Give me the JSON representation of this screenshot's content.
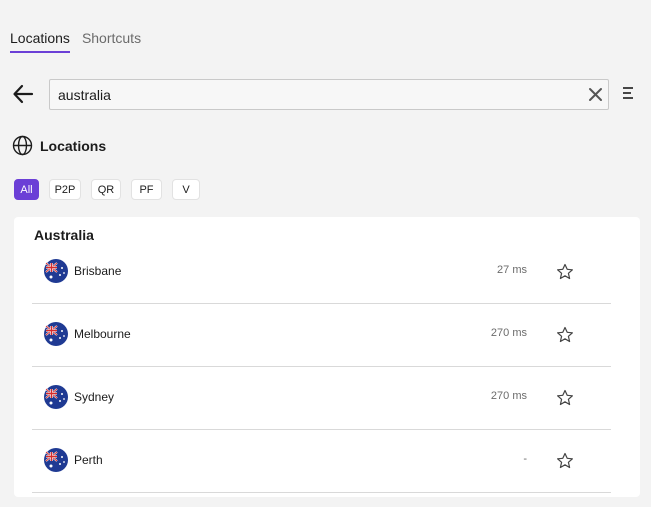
{
  "tabs": [
    {
      "label": "Locations",
      "active": true
    },
    {
      "label": "Shortcuts",
      "active": false
    }
  ],
  "search": {
    "value": "australia",
    "placeholder": ""
  },
  "icons": {
    "back": "arrow-left-icon",
    "clear": "close-icon",
    "menu": "list-menu-icon",
    "section": "globe-icon",
    "favorite": "star-outline-icon",
    "flag": "australia-flag-icon"
  },
  "section": {
    "title": "Locations"
  },
  "filters": [
    {
      "label": "All",
      "active": true
    },
    {
      "label": "P2P",
      "active": false
    },
    {
      "label": "QR",
      "active": false
    },
    {
      "label": "PF",
      "active": false
    },
    {
      "label": "V",
      "active": false
    }
  ],
  "country": {
    "name": "Australia",
    "servers": [
      {
        "city": "Brisbane",
        "latency": "27 ms"
      },
      {
        "city": "Melbourne",
        "latency": "270 ms"
      },
      {
        "city": "Sydney",
        "latency": "270 ms"
      },
      {
        "city": "Perth",
        "latency": "-"
      }
    ]
  },
  "colors": {
    "accent": "#6b3fd6",
    "background": "#f3f3f3",
    "card": "#ffffff"
  }
}
